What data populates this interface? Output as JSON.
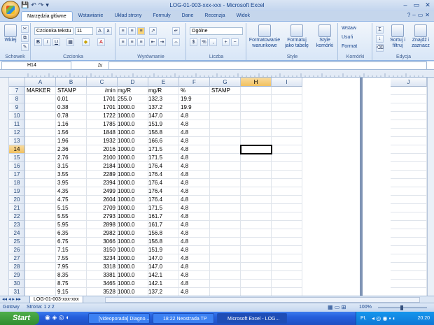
{
  "window": {
    "title": "LOG-01-003-xxx-xxx - Microsoft Excel",
    "qat": [
      "💾",
      "↶",
      "↷",
      "▾"
    ],
    "controls": [
      "–",
      "▭",
      "✕"
    ]
  },
  "ribbon_tabs": [
    "Narzędzia główne",
    "Wstawianie",
    "Układ strony",
    "Formuły",
    "Dane",
    "Recenzja",
    "Widok"
  ],
  "ribbon": {
    "paste": "Wklej",
    "font_name": "Czcionka tekstu",
    "font_size": "11",
    "number_format": "Ogólne",
    "conditional": "Formatowanie warunkowe",
    "format_table": "Formatuj jako tabelę",
    "cell_styles": "Style komórki",
    "insert": "Wstaw",
    "delete": "Usuń",
    "format": "Format",
    "sort": "Sortuj i filtruj",
    "find": "Znajdź i zaznacz",
    "groups": [
      "Schowek",
      "Czcionka",
      "Wyrównanie",
      "Liczba",
      "Style",
      "Komórki",
      "Edycja"
    ]
  },
  "formula_bar": {
    "cell_ref": "H14",
    "fx": "fx",
    "value": ""
  },
  "columns": [
    "A",
    "B",
    "C",
    "D",
    "E",
    "F",
    "G",
    "H",
    "I",
    "J"
  ],
  "rows": [
    {
      "n": "7",
      "a": "MARKER",
      "b": "STAMP",
      "c": "/min",
      "d": "mg/R",
      "e": "mg/R",
      "f": "%",
      "g": "STAMP"
    },
    {
      "n": "8",
      "a": "",
      "b": "0.01",
      "c": "1701",
      "d": "255.0",
      "e": "132.3",
      "f": "19.9",
      "g": ""
    },
    {
      "n": "9",
      "a": "",
      "b": "0.38",
      "c": "1701",
      "d": "1000.0",
      "e": "137.2",
      "f": "19.9",
      "g": ""
    },
    {
      "n": "10",
      "a": "",
      "b": "0.78",
      "c": "1722",
      "d": "1000.0",
      "e": "147.0",
      "f": "4.8",
      "g": ""
    },
    {
      "n": "11",
      "a": "",
      "b": "1.16",
      "c": "1785",
      "d": "1000.0",
      "e": "151.9",
      "f": "4.8",
      "g": ""
    },
    {
      "n": "12",
      "a": "",
      "b": "1.56",
      "c": "1848",
      "d": "1000.0",
      "e": "156.8",
      "f": "4.8",
      "g": ""
    },
    {
      "n": "13",
      "a": "",
      "b": "1.96",
      "c": "1932",
      "d": "1000.0",
      "e": "166.6",
      "f": "4.8",
      "g": ""
    },
    {
      "n": "14",
      "a": "",
      "b": "2.36",
      "c": "2016",
      "d": "1000.0",
      "e": "171.5",
      "f": "4.8",
      "g": ""
    },
    {
      "n": "15",
      "a": "",
      "b": "2.76",
      "c": "2100",
      "d": "1000.0",
      "e": "171.5",
      "f": "4.8",
      "g": ""
    },
    {
      "n": "16",
      "a": "",
      "b": "3.15",
      "c": "2184",
      "d": "1000.0",
      "e": "176.4",
      "f": "4.8",
      "g": ""
    },
    {
      "n": "17",
      "a": "",
      "b": "3.55",
      "c": "2289",
      "d": "1000.0",
      "e": "176.4",
      "f": "4.8",
      "g": ""
    },
    {
      "n": "18",
      "a": "",
      "b": "3.95",
      "c": "2394",
      "d": "1000.0",
      "e": "176.4",
      "f": "4.8",
      "g": ""
    },
    {
      "n": "19",
      "a": "",
      "b": "4.35",
      "c": "2499",
      "d": "1000.0",
      "e": "176.4",
      "f": "4.8",
      "g": ""
    },
    {
      "n": "20",
      "a": "",
      "b": "4.75",
      "c": "2604",
      "d": "1000.0",
      "e": "176.4",
      "f": "4.8",
      "g": ""
    },
    {
      "n": "21",
      "a": "",
      "b": "5.15",
      "c": "2709",
      "d": "1000.0",
      "e": "171.5",
      "f": "4.8",
      "g": ""
    },
    {
      "n": "22",
      "a": "",
      "b": "5.55",
      "c": "2793",
      "d": "1000.0",
      "e": "161.7",
      "f": "4.8",
      "g": ""
    },
    {
      "n": "23",
      "a": "",
      "b": "5.95",
      "c": "2898",
      "d": "1000.0",
      "e": "161.7",
      "f": "4.8",
      "g": ""
    },
    {
      "n": "24",
      "a": "",
      "b": "6.35",
      "c": "2982",
      "d": "1000.0",
      "e": "156.8",
      "f": "4.8",
      "g": ""
    },
    {
      "n": "25",
      "a": "",
      "b": "6.75",
      "c": "3066",
      "d": "1000.0",
      "e": "156.8",
      "f": "4.8",
      "g": ""
    },
    {
      "n": "26",
      "a": "",
      "b": "7.15",
      "c": "3150",
      "d": "1000.0",
      "e": "151.9",
      "f": "4.8",
      "g": ""
    },
    {
      "n": "27",
      "a": "",
      "b": "7.55",
      "c": "3234",
      "d": "1000.0",
      "e": "147.0",
      "f": "4.8",
      "g": ""
    },
    {
      "n": "28",
      "a": "",
      "b": "7.95",
      "c": "3318",
      "d": "1000.0",
      "e": "147.0",
      "f": "4.8",
      "g": ""
    },
    {
      "n": "29",
      "a": "",
      "b": "8.35",
      "c": "3381",
      "d": "1000.0",
      "e": "142.1",
      "f": "4.8",
      "g": ""
    },
    {
      "n": "30",
      "a": "",
      "b": "8.75",
      "c": "3465",
      "d": "1000.0",
      "e": "142.1",
      "f": "4.8",
      "g": ""
    },
    {
      "n": "31",
      "a": "",
      "b": "9.15",
      "c": "3528",
      "d": "1000.0",
      "e": "137.2",
      "f": "4.8",
      "g": ""
    },
    {
      "n": "32",
      "a": "",
      "b": "9.54",
      "c": "3591",
      "d": "1000.0",
      "e": "137.2",
      "f": "4.8",
      "g": ""
    }
  ],
  "active": {
    "cell": "H14",
    "row": "14",
    "col": "H"
  },
  "sheet_tab": "LOG-01-003-xxx-xxx",
  "status": {
    "ready": "Gotowy",
    "page": "Strona: 1 z 2",
    "zoom": "100%"
  },
  "taskbar": {
    "start": "Start",
    "tasks": [
      "[videoporada] Diagno...",
      "18:22 Neostrada TP",
      "Microsoft Excel - LOG..."
    ],
    "lang": "PL",
    "clock": "20:20"
  }
}
